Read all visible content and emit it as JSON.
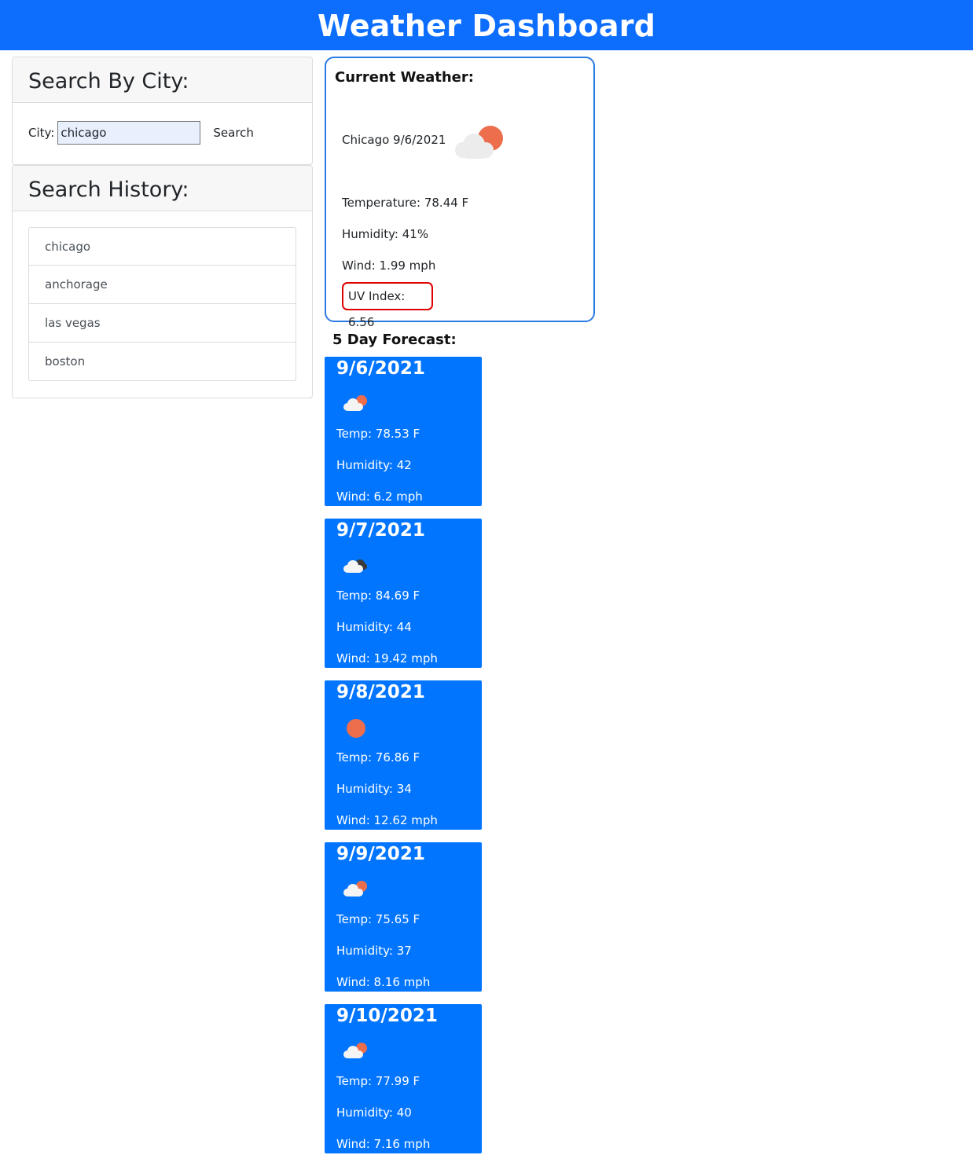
{
  "header": {
    "title": "Weather Dashboard"
  },
  "search": {
    "heading": "Search By City:",
    "city_label": "City:",
    "city_value": "chicago",
    "button_label": "Search"
  },
  "history": {
    "heading": "Search History:",
    "items": [
      "chicago",
      "anchorage",
      "las vegas",
      "boston"
    ]
  },
  "current": {
    "heading": "Current Weather:",
    "city_date": "Chicago 9/6/2021",
    "icon": "partly-cloudy-icon",
    "temperature": "Temperature: 78.44 F",
    "humidity": "Humidity: 41%",
    "wind": "Wind: 1.99 mph",
    "uv": "UV Index: 6.56"
  },
  "forecast": {
    "heading": "5 Day Forecast:",
    "days": [
      {
        "date": "9/6/2021",
        "icon": "partly-cloudy-icon",
        "temp": "Temp: 78.53 F",
        "humidity": "Humidity: 42",
        "wind": "Wind: 6.2 mph"
      },
      {
        "date": "9/7/2021",
        "icon": "cloudy-icon",
        "temp": "Temp: 84.69 F",
        "humidity": "Humidity: 44",
        "wind": "Wind: 19.42 mph"
      },
      {
        "date": "9/8/2021",
        "icon": "sun-icon",
        "temp": "Temp: 76.86 F",
        "humidity": "Humidity: 34",
        "wind": "Wind: 12.62 mph"
      },
      {
        "date": "9/9/2021",
        "icon": "partly-cloudy-icon",
        "temp": "Temp: 75.65 F",
        "humidity": "Humidity: 37",
        "wind": "Wind: 8.16 mph"
      },
      {
        "date": "9/10/2021",
        "icon": "partly-cloudy-icon",
        "temp": "Temp: 77.99 F",
        "humidity": "Humidity: 40",
        "wind": "Wind: 7.16 mph"
      }
    ]
  },
  "colors": {
    "brand": "#0d6efd",
    "forecast_card": "#0275ff",
    "uv_border": "#e00000",
    "sun": "#ec6e4c"
  }
}
